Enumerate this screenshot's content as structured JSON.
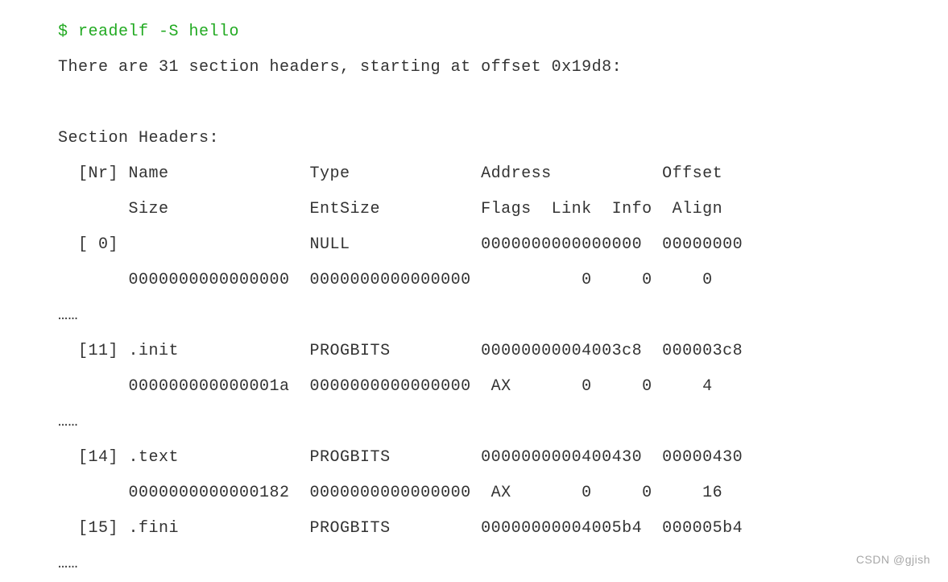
{
  "command": "$ readelf -S hello",
  "intro": "There are 31 section headers, starting at offset 0x19d8:",
  "blank1": "",
  "sh_title": "Section Headers:",
  "hdr1": "  [Nr] Name              Type             Address           Offset",
  "hdr2": "       Size              EntSize          Flags  Link  Info  Align",
  "r0a": "  [ 0]                   NULL             0000000000000000  00000000",
  "r0b": "       0000000000000000  0000000000000000           0     0     0",
  "dots1": "……",
  "r11a": "  [11] .init             PROGBITS         00000000004003c8  000003c8",
  "r11b": "       000000000000001a  0000000000000000  AX       0     0     4",
  "dots2": "……",
  "r14a": "  [14] .text             PROGBITS         0000000000400430  00000430",
  "r14b": "       0000000000000182  0000000000000000  AX       0     0     16",
  "r15a": "  [15] .fini             PROGBITS         00000000004005b4  000005b4",
  "dots3": "……",
  "watermark": "CSDN @gjish",
  "chart_data": {
    "type": "table",
    "title": "Section Headers",
    "columns": [
      "Nr",
      "Name",
      "Type",
      "Address",
      "Offset",
      "Size",
      "EntSize",
      "Flags",
      "Link",
      "Info",
      "Align"
    ],
    "rows": [
      {
        "Nr": 0,
        "Name": "",
        "Type": "NULL",
        "Address": "0000000000000000",
        "Offset": "00000000",
        "Size": "0000000000000000",
        "EntSize": "0000000000000000",
        "Flags": "",
        "Link": 0,
        "Info": 0,
        "Align": 0
      },
      {
        "Nr": 11,
        "Name": ".init",
        "Type": "PROGBITS",
        "Address": "00000000004003c8",
        "Offset": "000003c8",
        "Size": "000000000000001a",
        "EntSize": "0000000000000000",
        "Flags": "AX",
        "Link": 0,
        "Info": 0,
        "Align": 4
      },
      {
        "Nr": 14,
        "Name": ".text",
        "Type": "PROGBITS",
        "Address": "0000000000400430",
        "Offset": "00000430",
        "Size": "0000000000000182",
        "EntSize": "0000000000000000",
        "Flags": "AX",
        "Link": 0,
        "Info": 0,
        "Align": 16
      },
      {
        "Nr": 15,
        "Name": ".fini",
        "Type": "PROGBITS",
        "Address": "00000000004005b4",
        "Offset": "000005b4",
        "Size": "",
        "EntSize": "",
        "Flags": "",
        "Link": "",
        "Info": "",
        "Align": ""
      }
    ],
    "total_sections": 31,
    "start_offset": "0x19d8"
  }
}
